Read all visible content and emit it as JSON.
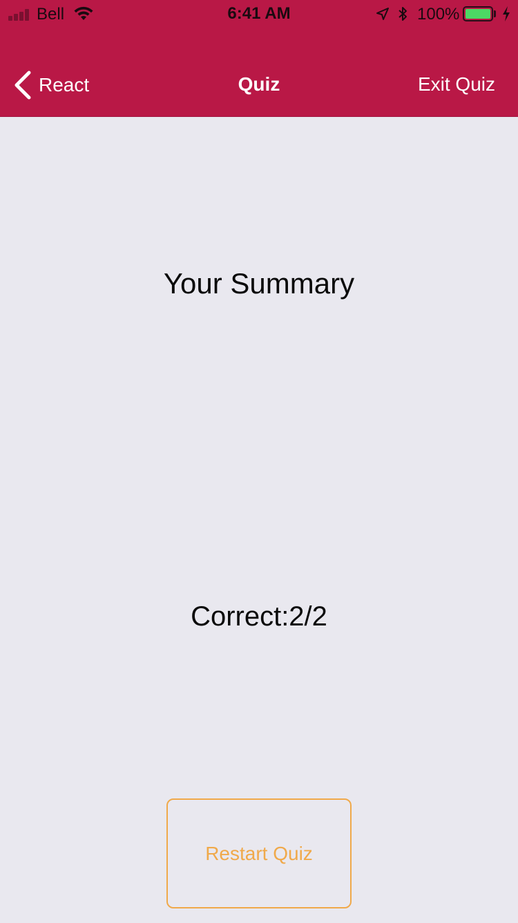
{
  "status_bar": {
    "carrier": "Bell",
    "time": "6:41 AM",
    "battery_percent": "100%",
    "battery_level": 1.0,
    "icons": [
      "signal-icon",
      "wifi-icon",
      "location-icon",
      "bluetooth-icon",
      "battery-icon",
      "charging-bolt-icon"
    ]
  },
  "nav_bar": {
    "back_label": "React",
    "title": "Quiz",
    "right_label": "Exit Quiz",
    "background_color": "#b91846"
  },
  "summary": {
    "heading": "Your Summary",
    "score_text": "Correct:2/2"
  },
  "actions": {
    "restart_label": "Restart Quiz",
    "accent_color": "#f0a94a"
  }
}
